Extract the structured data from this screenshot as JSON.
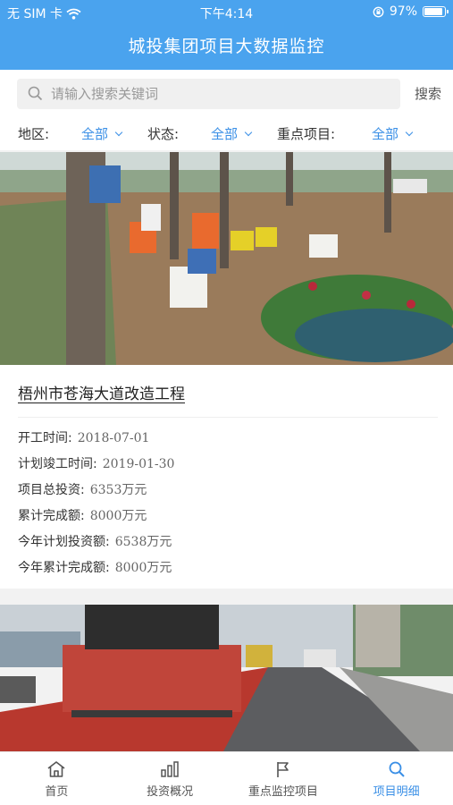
{
  "status": {
    "carrier": "无 SIM 卡",
    "time": "下午4:14",
    "battery": "97%",
    "battery_level": 0.97
  },
  "header": {
    "title": "城投集团项目大数据监控"
  },
  "search": {
    "placeholder": "请输入搜索关键词",
    "button": "搜索"
  },
  "filters": [
    {
      "label": "地区:",
      "value": "全部"
    },
    {
      "label": "状态:",
      "value": "全部"
    },
    {
      "label": "重点项目:",
      "value": "全部"
    }
  ],
  "project": {
    "name": "梧州市苍海大道改造工程",
    "rows": [
      {
        "label": "开工时间:",
        "value": "2018-07-01"
      },
      {
        "label": "计划竣工时间:",
        "value": "2019-01-30"
      },
      {
        "label": "项目总投资:",
        "value": "6353万元"
      },
      {
        "label": "累计完成额:",
        "value": "8000万元"
      },
      {
        "label": "今年计划投资额:",
        "value": "6538万元"
      },
      {
        "label": "今年累计完成额:",
        "value": "8000万元"
      }
    ]
  },
  "tabs": [
    {
      "label": "首页",
      "icon": "home-icon"
    },
    {
      "label": "投资概况",
      "icon": "bar-chart-icon"
    },
    {
      "label": "重点监控项目",
      "icon": "flag-icon"
    },
    {
      "label": "项目明细",
      "icon": "search-icon"
    }
  ],
  "colors": {
    "primary": "#4aa3ee",
    "accent": "#3a8fe6"
  }
}
